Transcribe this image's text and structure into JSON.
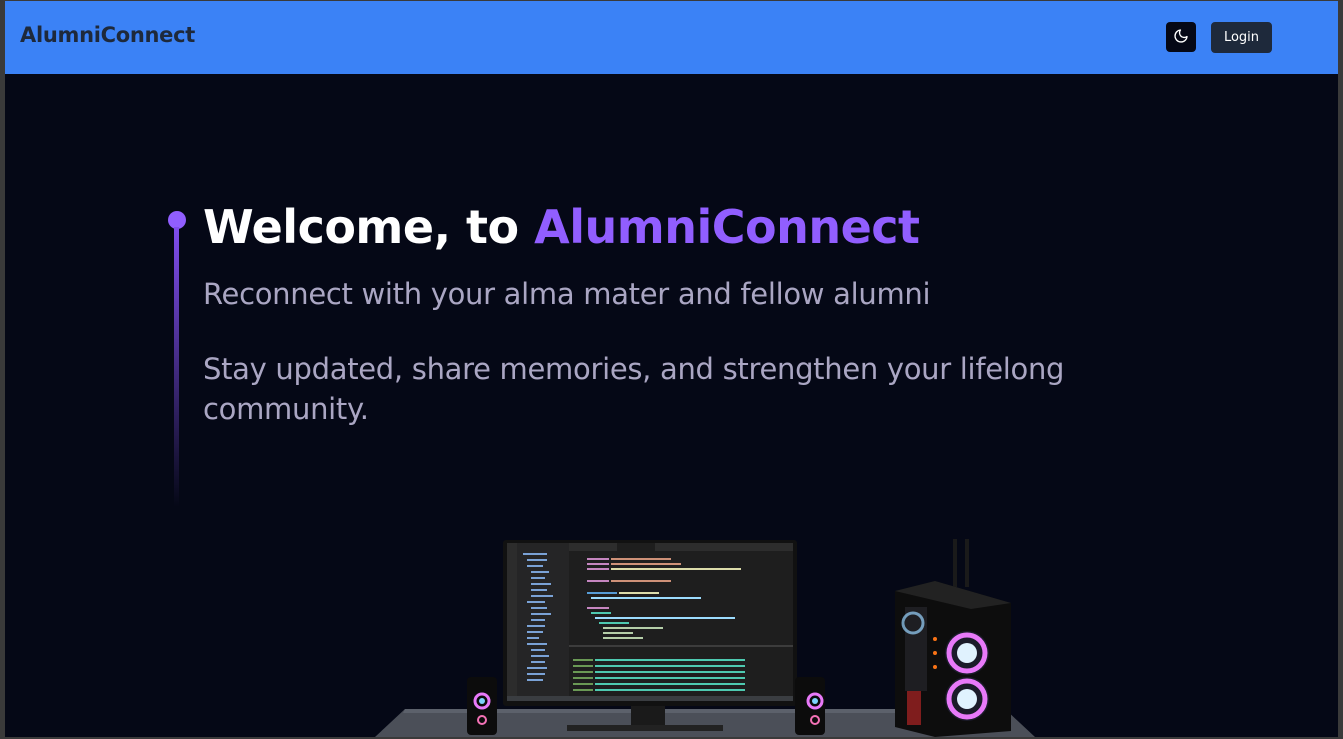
{
  "navbar": {
    "brand": "AlumniConnect",
    "theme_toggle_icon": "moon-icon",
    "login_label": "Login"
  },
  "hero": {
    "title_prefix": "Welcome, to ",
    "title_highlight": "AlumniConnect",
    "subtitle": "Reconnect with your alma mater and fellow alumni",
    "description": "Stay updated, share memories, and strengthen your lifelong community."
  },
  "colors": {
    "navbar_bg": "#3b82f6",
    "page_bg": "#050816",
    "accent": "#915eff",
    "muted_text": "#aaa6c3",
    "button_bg": "#1e293b"
  },
  "illustration": {
    "icons": [
      "monitor-icon",
      "speaker-icon",
      "pc-tower-icon",
      "desk-icon"
    ]
  }
}
